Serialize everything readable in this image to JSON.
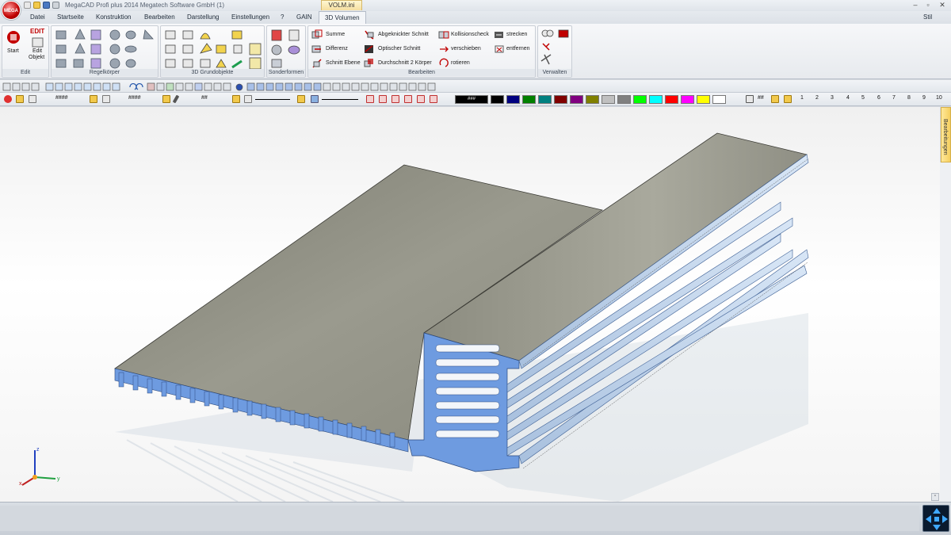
{
  "window": {
    "title": "MegaCAD Profi plus 2014  Megatech Software GmbH (1)",
    "file_tab": "VOLM.ini",
    "logo_text": "MEGA"
  },
  "menu": [
    "Datei",
    "Startseite",
    "Konstruktion",
    "Bearbeiten",
    "Darstellung",
    "Einstellungen",
    "?",
    "GAIN",
    "3D Volumen"
  ],
  "menu_right": "Stil",
  "ribbon": {
    "edit_group": {
      "label": "Edit",
      "start": "Start",
      "edit_badge": "EDIT",
      "edit_obj_1": "Edit",
      "edit_obj_2": "Objekt"
    },
    "regelkoerper": "Regelkörper",
    "grundobjekte": "3D Grundobjekte",
    "sonderformen": "Sonderformen",
    "bearbeiten": {
      "label": "Bearbeiten",
      "col1": [
        "Summe",
        "Differenz",
        "Schnitt Ebene"
      ],
      "col2": [
        "Abgeknickter Schnitt",
        "Optischer Schnitt",
        "Durchschnitt 2 Körper"
      ],
      "col3": [
        "Kollisionscheck",
        "verschieben",
        "rotieren"
      ],
      "col4": [
        "strecken",
        "entfernen"
      ]
    },
    "verwalten": "Verwalten"
  },
  "toolbar2": {
    "hash1": "####",
    "hash2": "####",
    "hash3": "##",
    "color_hash": "###",
    "grid_hash": "##",
    "numbers": [
      "1",
      "2",
      "3",
      "4",
      "5",
      "6",
      "7",
      "8",
      "9",
      "10"
    ],
    "colors": [
      "#000000",
      "#000080",
      "#008000",
      "#008080",
      "#800000",
      "#800080",
      "#808000",
      "#c0c0c0",
      "#808080",
      "#00ff00",
      "#00ffff",
      "#ff0000",
      "#ff00ff",
      "#ffff00",
      "#ffffff"
    ]
  },
  "side_tab": "Bearbeitungen",
  "axes": {
    "x": "x",
    "y": "y",
    "z": "z"
  },
  "colors": {
    "profile_face": "#6e9be0",
    "top_face": "#8d8d82",
    "ribbon_accent": "#c00000"
  }
}
